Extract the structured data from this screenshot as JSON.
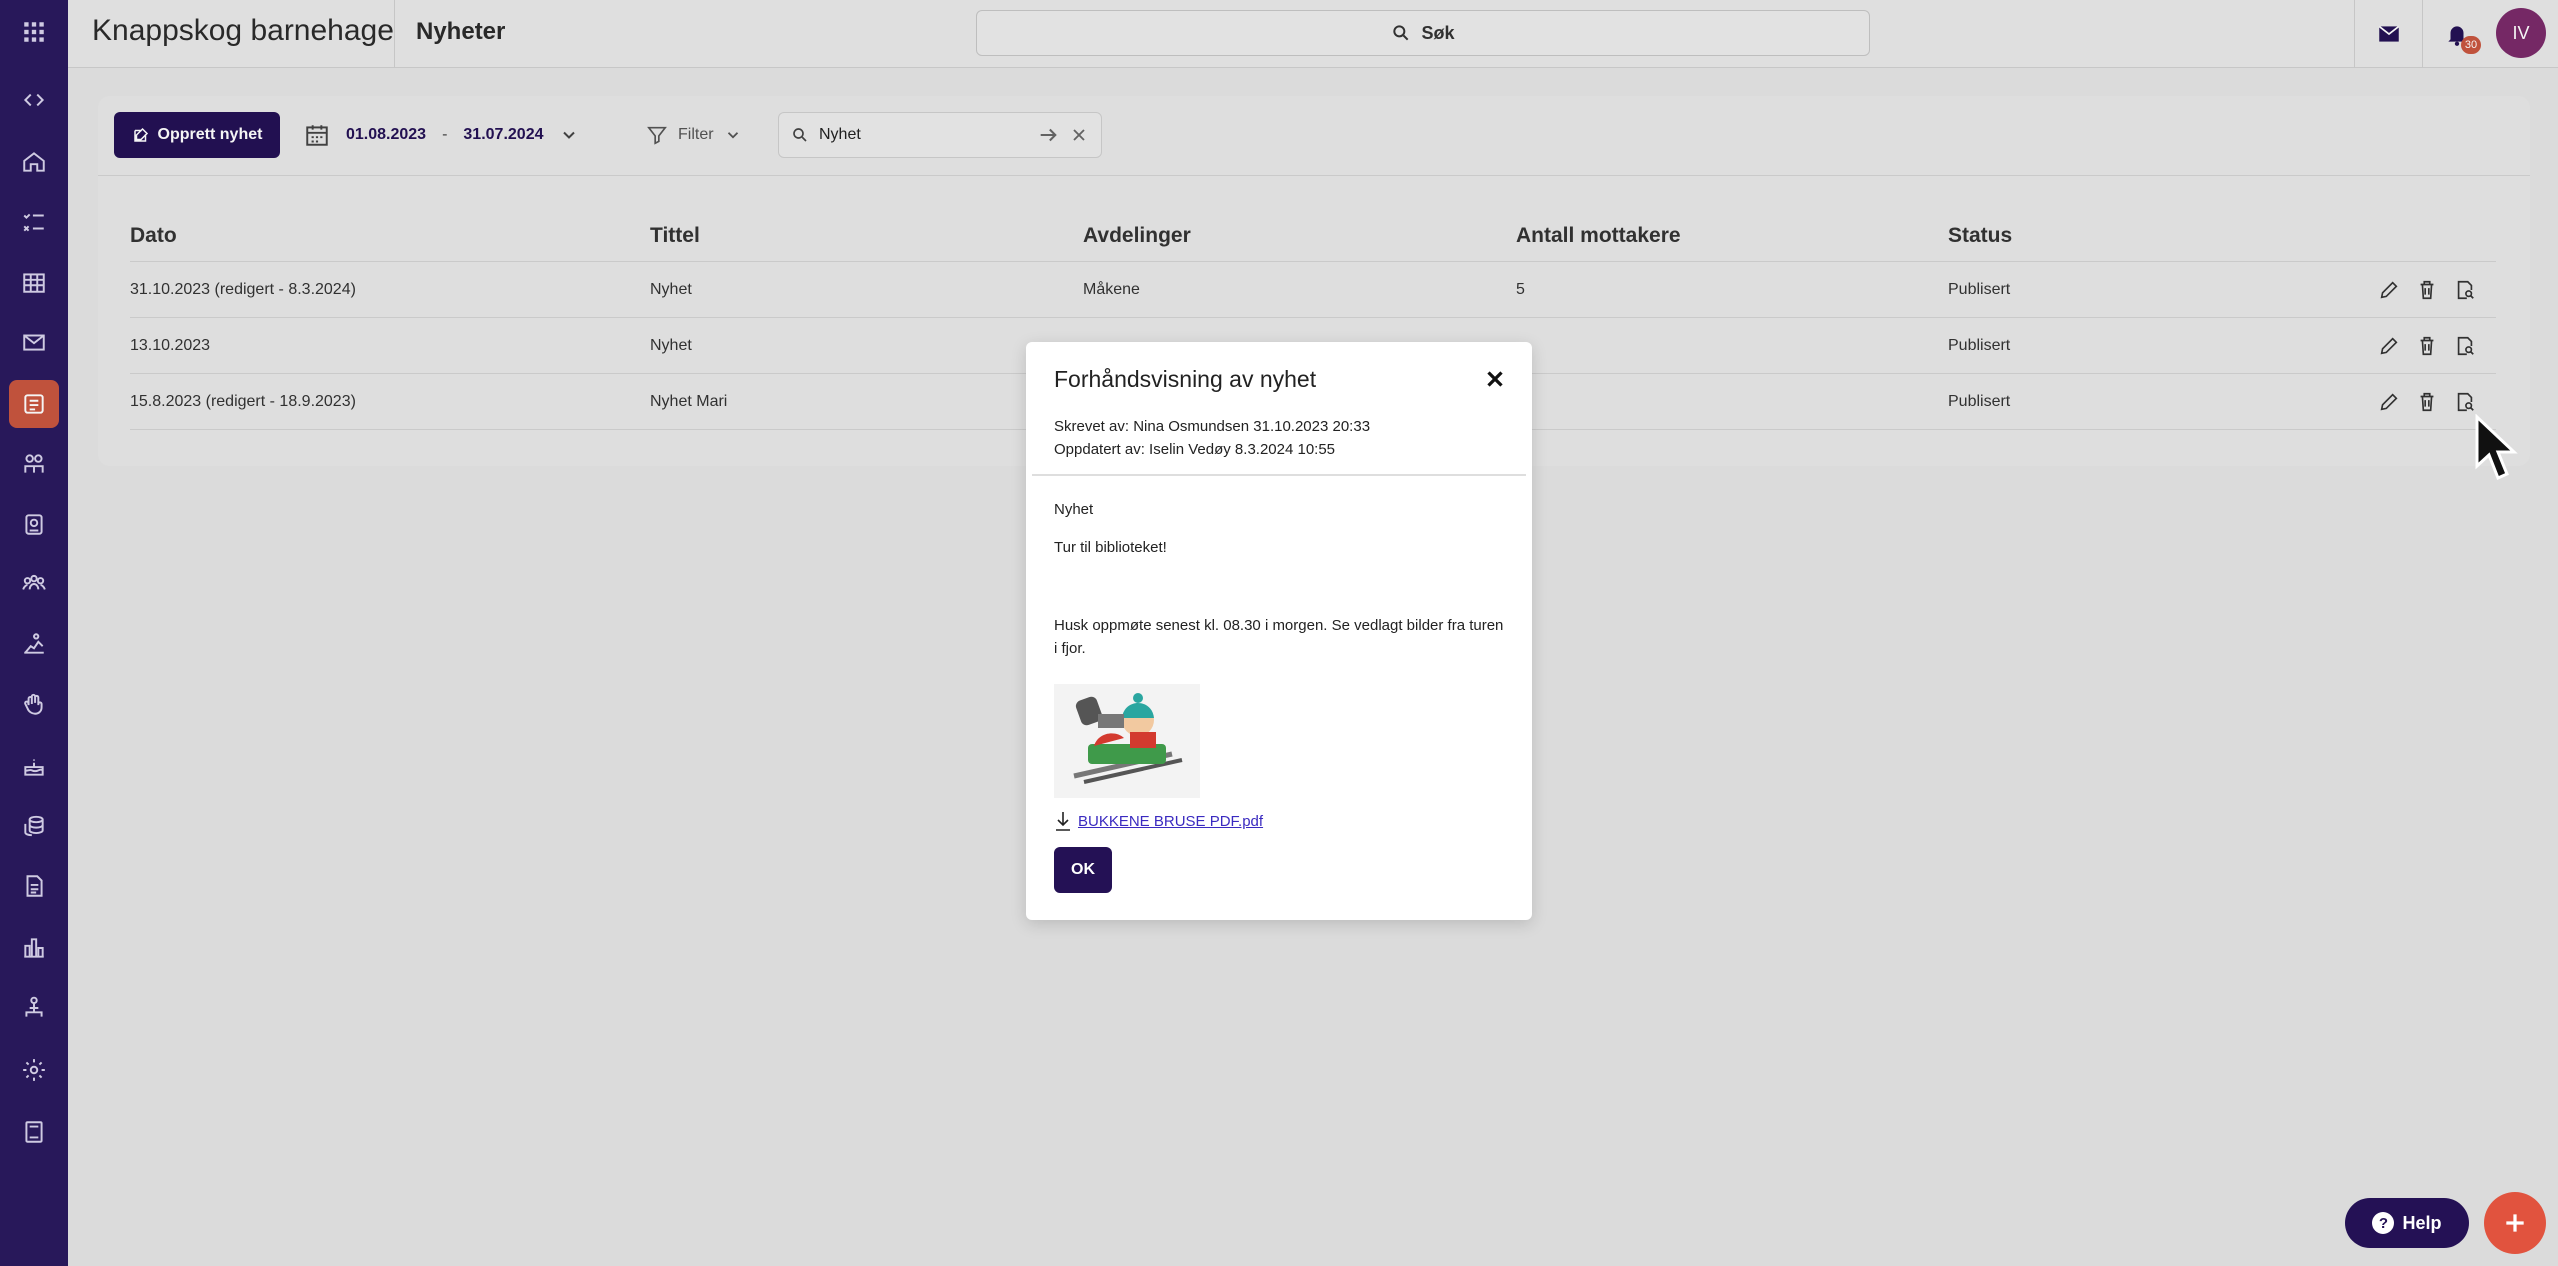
{
  "app": {
    "brand": "Knappskog barnehage",
    "page_title": "Nyheter",
    "search_label": "Søk",
    "notification_count": "30",
    "user_initials": "IV"
  },
  "sidebar": {
    "items": [
      {
        "icon": "code-toggle-icon"
      },
      {
        "icon": "home-icon"
      },
      {
        "icon": "checklist-icon"
      },
      {
        "icon": "calendar-grid-icon"
      },
      {
        "icon": "mail-icon"
      },
      {
        "icon": "news-icon",
        "active": true
      },
      {
        "icon": "children-icon"
      },
      {
        "icon": "badge-icon"
      },
      {
        "icon": "group-icon"
      },
      {
        "icon": "activity-icon"
      },
      {
        "icon": "hand-icon"
      },
      {
        "icon": "cake-icon"
      },
      {
        "icon": "coins-icon"
      },
      {
        "icon": "document-icon"
      },
      {
        "icon": "bar-chart-icon"
      },
      {
        "icon": "org-icon"
      },
      {
        "icon": "settings-icon"
      },
      {
        "icon": "book-icon"
      }
    ]
  },
  "toolbar": {
    "create_label": "Opprett nyhet",
    "date_from": "01.08.2023",
    "date_separator": "-",
    "date_to": "31.07.2024",
    "filter_label": "Filter",
    "search_value": "Nyhet"
  },
  "table": {
    "headers": [
      "Dato",
      "Tittel",
      "Avdelinger",
      "Antall mottakere",
      "Status"
    ],
    "rows": [
      {
        "date": "31.10.2023 (redigert - 8.3.2024)",
        "title": "Nyhet",
        "department": "Måkene",
        "recipients": "5",
        "status": "Publisert"
      },
      {
        "date": "13.10.2023",
        "title": "Nyhet",
        "department": "",
        "recipients": "",
        "status": "Publisert"
      },
      {
        "date": "15.8.2023 (redigert - 18.9.2023)",
        "title": "Nyhet Mari",
        "department": "",
        "recipients": "",
        "status": "Publisert"
      }
    ]
  },
  "modal": {
    "title": "Forhåndsvisning av nyhet",
    "written_by": "Skrevet av: Nina Osmundsen 31.10.2023 20:33",
    "updated_by": "Oppdatert av: Iselin Vedøy 8.3.2024 10:55",
    "news_title": "Nyhet",
    "subtitle": "Tur til biblioteket!",
    "body": "Husk oppmøte senest kl. 08.30 i morgen. Se vedlagt bilder fra turen i fjor.",
    "attachment_name": "BUKKENE BRUSE PDF.pdf",
    "ok_label": "OK"
  },
  "floating": {
    "help_label": "Help"
  },
  "colors": {
    "sidebar": "#2a1a5e",
    "primary": "#241155",
    "accent": "#e1533e"
  }
}
